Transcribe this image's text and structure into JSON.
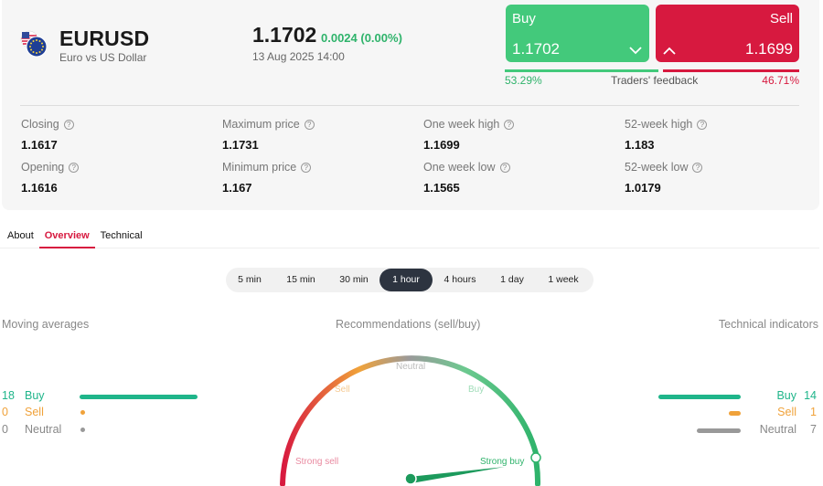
{
  "instrument": {
    "symbol": "EURUSD",
    "description": "Euro vs US Dollar",
    "price": "1.1702",
    "change": "0.0024 (0.00%)",
    "timestamp": "13 Aug 2025 14:00"
  },
  "trade": {
    "buy_label": "Buy",
    "buy_price": "1.1702",
    "sell_label": "Sell",
    "sell_price": "1.1699",
    "feedback_label": "Traders' feedback",
    "buy_pct": "53.29%",
    "sell_pct": "46.71%",
    "buy_share": 0.5329,
    "sell_share": 0.4671
  },
  "stats": [
    {
      "label": "Closing",
      "value": "1.1617"
    },
    {
      "label": "Maximum price",
      "value": "1.1731"
    },
    {
      "label": "One week high",
      "value": "1.1699"
    },
    {
      "label": "52-week high",
      "value": "1.183"
    },
    {
      "label": "Opening",
      "value": "1.1616"
    },
    {
      "label": "Minimum price",
      "value": "1.167"
    },
    {
      "label": "One week low",
      "value": "1.1565"
    },
    {
      "label": "52-week low",
      "value": "1.0179"
    }
  ],
  "tabs": [
    {
      "label": "About",
      "active": false
    },
    {
      "label": "Overview",
      "active": true
    },
    {
      "label": "Technical",
      "active": false
    }
  ],
  "periods": [
    {
      "label": "5 min",
      "active": false
    },
    {
      "label": "15 min",
      "active": false
    },
    {
      "label": "30 min",
      "active": false
    },
    {
      "label": "1 hour",
      "active": true
    },
    {
      "label": "4 hours",
      "active": false
    },
    {
      "label": "1 day",
      "active": false
    },
    {
      "label": "1 week",
      "active": false
    }
  ],
  "moving_averages": {
    "title": "Moving averages",
    "buy": {
      "label": "Buy",
      "count": "18"
    },
    "sell": {
      "label": "Sell",
      "count": "0"
    },
    "neutral": {
      "label": "Neutral",
      "count": "0"
    }
  },
  "recommendations": {
    "title": "Recommendations (sell/buy)",
    "labels": {
      "strong_sell": "Strong sell",
      "sell": "Sell",
      "neutral": "Neutral",
      "buy": "Buy",
      "strong_buy": "Strong buy"
    },
    "needle": "Strong buy"
  },
  "technical_indicators": {
    "title": "Technical indicators",
    "buy": {
      "label": "Buy",
      "count": "14"
    },
    "sell": {
      "label": "Sell",
      "count": "1"
    },
    "neutral": {
      "label": "Neutral",
      "count": "7"
    }
  },
  "colors": {
    "buy": "#43c97b",
    "sell": "#d7193f",
    "indicator_buy": "#1fb58a",
    "indicator_sell": "#f0a23a",
    "indicator_neutral": "#999999",
    "active_period": "#2d3440"
  },
  "icons": {
    "flag": "eu-us-flag-icon",
    "buy_chevron": "chevron-down-icon",
    "sell_chevron": "chevron-up-icon",
    "help": "question-circle-icon"
  }
}
